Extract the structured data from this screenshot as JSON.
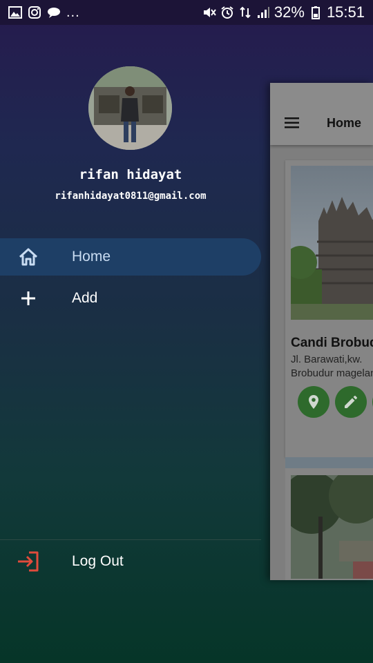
{
  "status_bar": {
    "left_icons": [
      "gallery-icon",
      "instagram-icon",
      "chat-icon"
    ],
    "more": "...",
    "battery_percent": "32%",
    "time": "15:51"
  },
  "drawer": {
    "user": {
      "name": "rifan hidayat",
      "email": "rifanhidayat0811@gmail.com"
    },
    "items": [
      {
        "label": "Home",
        "icon": "home-icon",
        "active": true
      },
      {
        "label": "Add",
        "icon": "plus-icon",
        "active": false
      }
    ],
    "logout": {
      "label": "Log Out",
      "icon": "logout-icon"
    }
  },
  "page": {
    "title": "Home",
    "cards": [
      {
        "title": "Candi Brobudur",
        "address": "Jl. Barawati,kw. Brobudur magelang"
      }
    ]
  },
  "colors": {
    "active_item_bg": "#1e3f66",
    "fab_green": "#2e6a2c",
    "logout_red": "#e04b3c"
  }
}
